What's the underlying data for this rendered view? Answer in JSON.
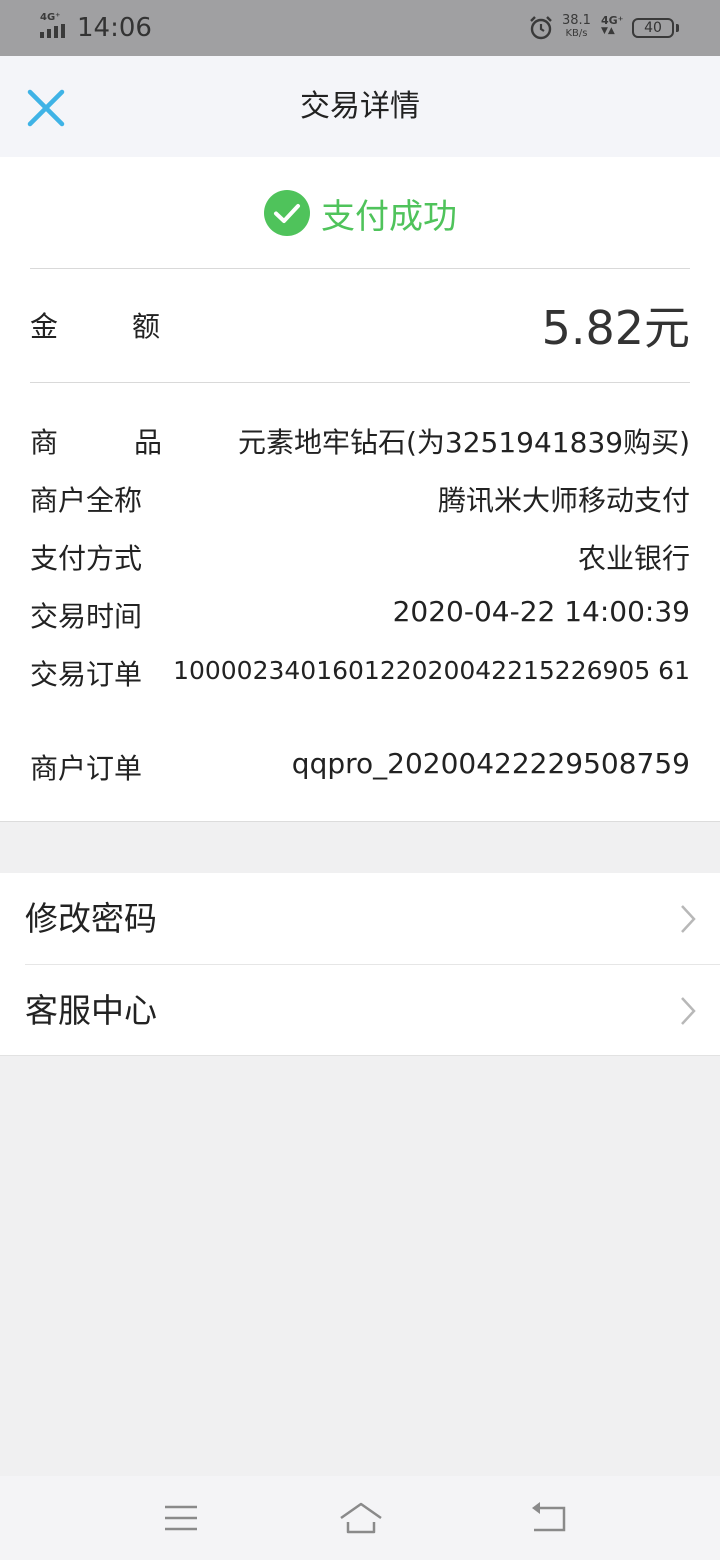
{
  "status_bar": {
    "network_left": "4G⁺",
    "time": "14:06",
    "speed_value": "38.1",
    "speed_unit": "KB/s",
    "network_right": "4G⁺",
    "battery": "40"
  },
  "header": {
    "title": "交易详情",
    "close_icon": "close-icon"
  },
  "result": {
    "icon": "check-circle-icon",
    "text": "支付成功",
    "color": "#4fc35b"
  },
  "amount": {
    "label_char1": "金",
    "label_char2": "额",
    "value": "5.82元"
  },
  "details": {
    "product_label_char1": "商",
    "product_label_char2": "品",
    "product_value": "元素地牢钻石(为3251941839购买)",
    "merchant_label": "商户全称",
    "merchant_value": "腾讯米大师移动支付",
    "payment_label": "支付方式",
    "payment_value": "农业银行",
    "time_label": "交易时间",
    "time_value": "2020-04-22 14:00:39",
    "trade_order_label": "交易订单",
    "trade_order_value": "100002340160122020042215226905 61",
    "merchant_order_label": "商户订单",
    "merchant_order_value": "qqpro_20200422229508759"
  },
  "menu": {
    "items": [
      {
        "label": "修改密码",
        "icon": "chevron-right-icon"
      },
      {
        "label": "客服中心",
        "icon": "chevron-right-icon"
      }
    ]
  },
  "navbar": {
    "icons": [
      "menu-icon",
      "home-icon",
      "back-icon"
    ]
  },
  "colors": {
    "accent": "#3fb3e6",
    "success": "#4fc35b"
  }
}
